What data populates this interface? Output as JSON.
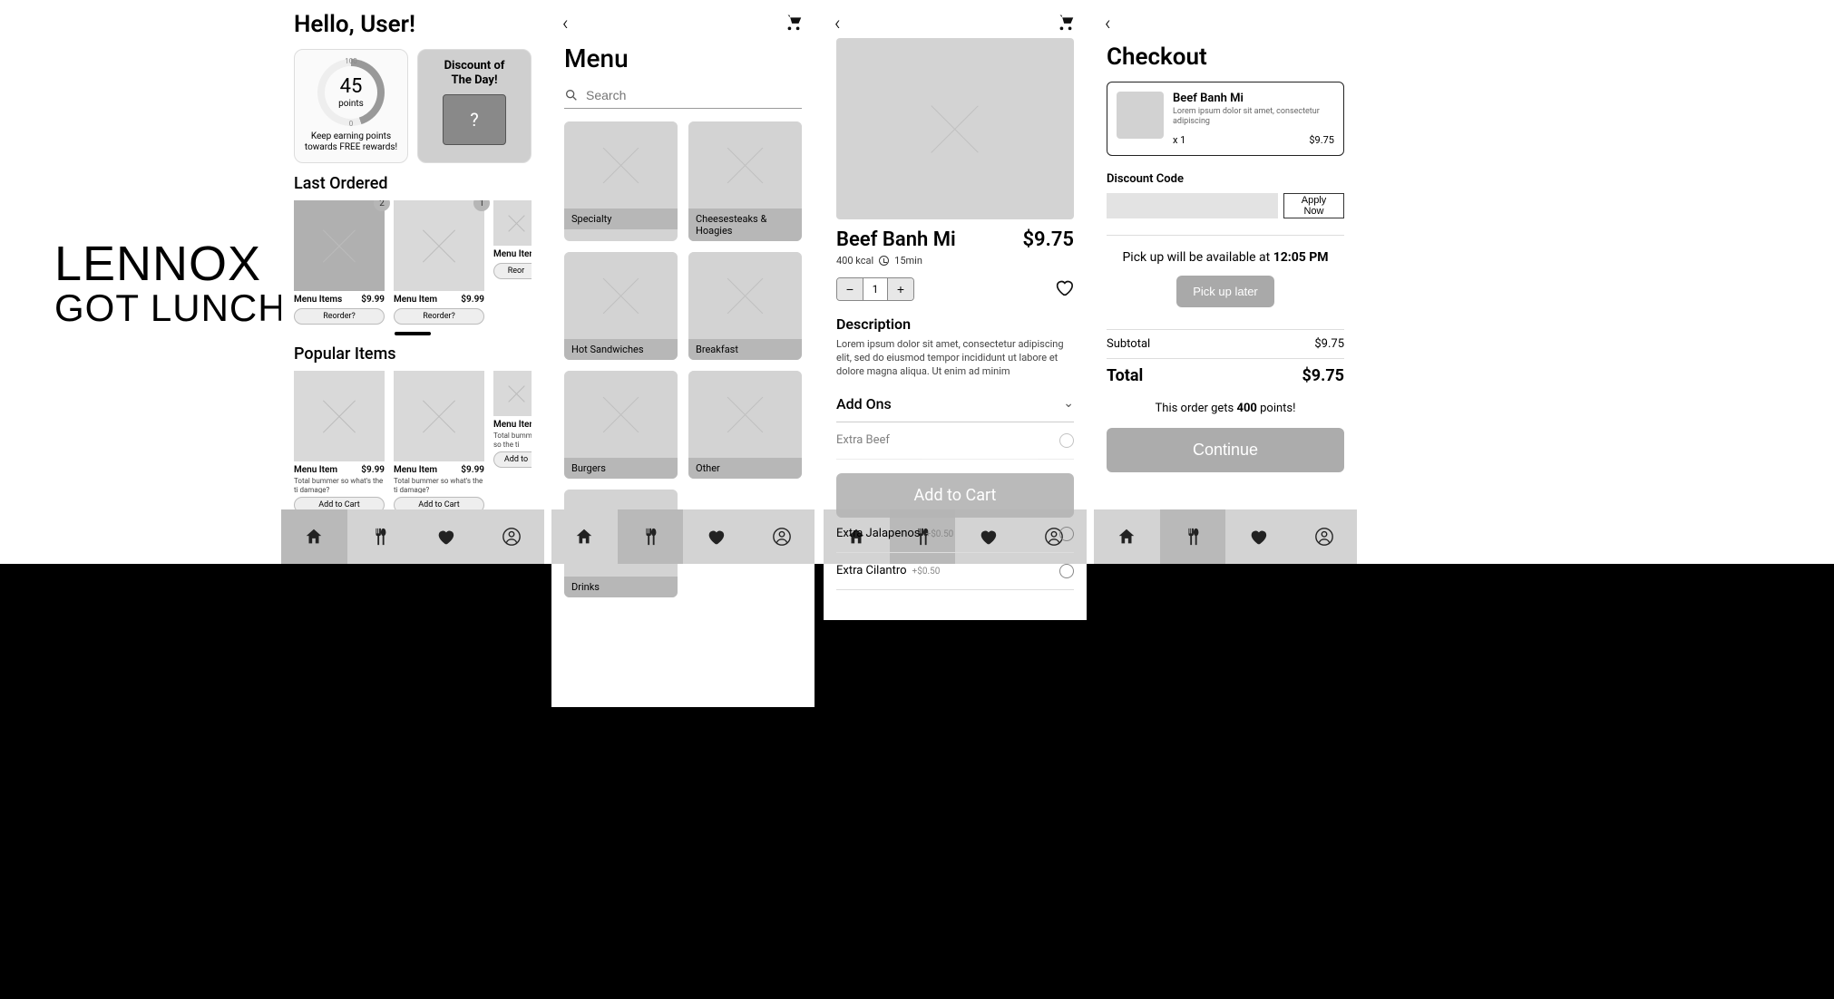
{
  "brand": {
    "line1": "LENNOX",
    "line2": "GOT LUNCH"
  },
  "home": {
    "greeting": "Hello, User!",
    "points": {
      "value": "45",
      "label": "points",
      "max": "100",
      "min": "0",
      "caption": "Keep earning points towards FREE rewards!"
    },
    "discount": {
      "title_l1": "Discount of",
      "title_l2": "The Day!",
      "mark": "?"
    },
    "last_ordered_h": "Last Ordered",
    "last": [
      {
        "name": "Menu Items",
        "price": "$9.99",
        "badge": "2",
        "btn": "Reorder?"
      },
      {
        "name": "Menu Item",
        "price": "$9.99",
        "badge": "1",
        "btn": "Reorder?"
      },
      {
        "name": "Menu Item",
        "price": "",
        "badge": "",
        "btn": "Reor"
      }
    ],
    "popular_h": "Popular Items",
    "popular": [
      {
        "name": "Menu Item",
        "price": "$9.99",
        "desc": "Total bummer so what's the ti damage?",
        "btn": "Add to Cart"
      },
      {
        "name": "Menu Item",
        "price": "$9.99",
        "desc": "Total bummer so what's the ti damage?",
        "btn": "Add to Cart"
      },
      {
        "name": "Menu Item",
        "price": "",
        "desc": "Total bummer so the ti damage?",
        "btn": "Add to"
      }
    ]
  },
  "menu": {
    "title": "Menu",
    "search_placeholder": "Search",
    "categories": [
      "Specialty",
      "Cheesesteaks & Hoagies",
      "Hot Sandwiches",
      "Breakfast",
      "Burgers",
      "Other",
      "Drinks"
    ]
  },
  "detail": {
    "name": "Beef Banh Mi",
    "price": "$9.75",
    "kcal": "400 kcal",
    "time": "15min",
    "qty": "1",
    "desc_h": "Description",
    "desc": "Lorem ipsum dolor sit amet, consectetur adipiscing elit, sed do eiusmod tempor incididunt ut labore et dolore magna aliqua. Ut enim ad minim",
    "addons_h": "Add Ons",
    "addons": [
      {
        "name": "Extra Beef",
        "price": ""
      },
      {
        "name": "Extra Jalapenos",
        "price": "+$0.50"
      },
      {
        "name": "Extra Cilantro",
        "price": "+$0.50"
      }
    ],
    "add_to_cart": "Add to Cart"
  },
  "checkout": {
    "title": "Checkout",
    "item": {
      "name": "Beef Banh Mi",
      "desc": "Lorem ipsum dolor sit amet, consectetur adipiscing",
      "qty": "x 1",
      "price": "$9.75"
    },
    "discount_h": "Discount Code",
    "apply": "Apply Now",
    "pickup_pre": "Pick up will be available at ",
    "pickup_time": "12:05 PM",
    "pickup_later": "Pick up later",
    "subtotal_l": "Subtotal",
    "subtotal_v": "$9.75",
    "total_l": "Total",
    "total_v": "$9.75",
    "points_pre": "This order gets ",
    "points_n": "400",
    "points_post": " points!",
    "continue": "Continue"
  }
}
